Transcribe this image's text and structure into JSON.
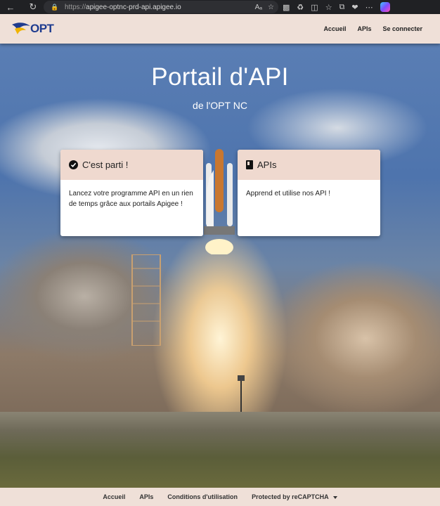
{
  "browser": {
    "url_protocol": "https://",
    "url_host": "apigee-optnc-prd-api.apigee.io",
    "icons": [
      "back-icon",
      "refresh-icon",
      "lock-icon",
      "read-aloud-icon",
      "favorite-icon",
      "qr-icon",
      "extensions-icon",
      "split-screen-icon",
      "favorites-bar-icon",
      "collections-icon",
      "performance-icon",
      "more-icon",
      "copilot-icon"
    ],
    "aa_label": "Aₐ"
  },
  "header": {
    "logo_text": "OPT",
    "nav": [
      "Accueil",
      "APIs",
      "Se connecter"
    ]
  },
  "hero": {
    "title": "Portail d'API",
    "subtitle": "de l'OPT NC"
  },
  "cards": [
    {
      "title": "C'est parti !",
      "icon": "check-circle-icon",
      "body": "Lancez votre programme API en un rien de temps grâce aux portails Apigee !"
    },
    {
      "title": "APIs",
      "icon": "book-icon",
      "body": "Apprend et utilise nos API !"
    }
  ],
  "footer": {
    "links": [
      "Accueil",
      "APIs",
      "Conditions d'utilisation",
      "Protected by reCAPTCHA"
    ]
  },
  "colors": {
    "header_bg": "#efe0d8",
    "card_head_bg": "#efd9cf",
    "logo_blue": "#1f3c8f"
  }
}
